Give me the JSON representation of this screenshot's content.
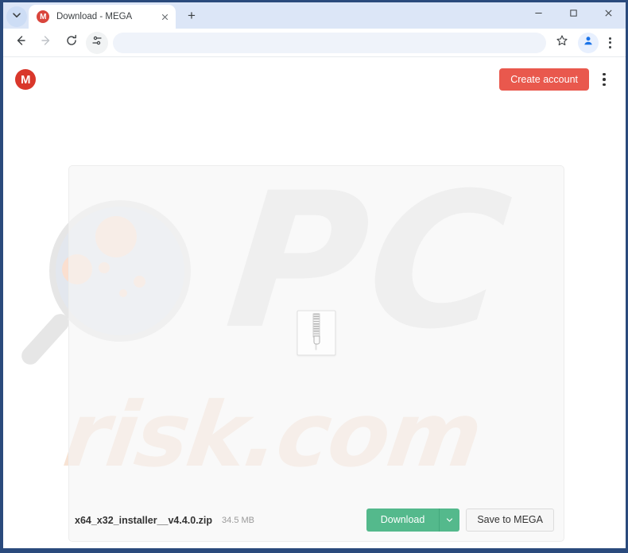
{
  "browser": {
    "tab_search_icon": "chevron-down-icon",
    "tab": {
      "favicon_letter": "M",
      "title": "Download - MEGA",
      "close_icon": "close-icon"
    },
    "new_tab_label": "+",
    "window_controls": {
      "minimize": "minimize-icon",
      "maximize": "maximize-icon",
      "close": "close-icon"
    },
    "toolbar": {
      "back_icon": "back-arrow-icon",
      "forward_icon": "forward-arrow-icon",
      "reload_icon": "reload-icon",
      "tracking_icon": "tracking-protection-icon",
      "address_value": "",
      "address_placeholder": "",
      "bookmark_icon": "star-icon",
      "profile_icon": "avatar-icon",
      "menu_icon": "three-dots-vertical-icon"
    }
  },
  "site": {
    "logo_letter": "M",
    "logo_name": "mega-logo",
    "create_account_label": "Create account",
    "menu_icon": "three-dots-vertical-icon",
    "watermarks": {
      "primary": "PC",
      "secondary": "risk.com",
      "magnifier_icon": "magnifying-glass-watermark"
    }
  },
  "file_card": {
    "preview_icon": "zip-file-icon",
    "name": "x64_x32_installer__v4.4.0.zip",
    "size": "34.5 MB",
    "download_label": "Download",
    "download_caret_icon": "chevron-down-icon",
    "save_label": "Save to MEGA"
  },
  "colors": {
    "brand_red": "#d9372b",
    "create_account_bg": "#e9584d",
    "download_green": "#54b98c",
    "window_border": "#2a4a7c",
    "tabstrip_bg": "#dce6f7"
  }
}
